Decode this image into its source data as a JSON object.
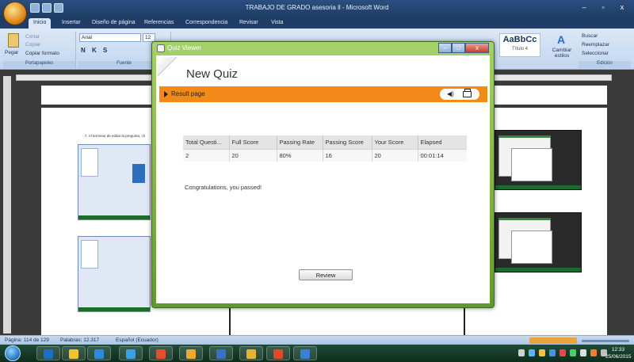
{
  "word": {
    "window_title": "TRABAJO DE GRADO asesoria ll - Microsoft Word",
    "window_controls": {
      "minimize": "–",
      "restore": "▫",
      "close": "x"
    },
    "tabs": [
      "Inicio",
      "Insertar",
      "Diseño de página",
      "Referencias",
      "Correspondencia",
      "Revisar",
      "Vista"
    ],
    "ribbon": {
      "clipboard": {
        "paste": "Pegar",
        "cut": "Cortar",
        "copy": "Copiar",
        "format_painter": "Copiar formato",
        "group": "Portapapeles"
      },
      "font": {
        "name": "Arial",
        "size": "12",
        "group": "Fuente"
      },
      "styles": {
        "preview": "AaBbCc",
        "name": "Título 4",
        "change": "Cambiar estilos"
      },
      "editing": {
        "find": "Buscar",
        "replace": "Reemplazar",
        "select": "Seleccionar",
        "group": "Edición"
      }
    },
    "document_text": "7. Al terminar de editar la pregunta, cli",
    "statusbar": {
      "page": "Página: 114 de 129",
      "words": "Palabras: 12.317",
      "language": "Español (Ecuador)"
    }
  },
  "taskbar": {
    "time": "12:33",
    "date": "25/06/2015",
    "app_colors": [
      "#1e6fc1",
      "#f2c230",
      "#2d8ad6",
      "#3aa0e0",
      "#e74c2c",
      "#f0a830",
      "#3b6fbf",
      "#e7b23c",
      "#d94d2b",
      "#3a7fd5"
    ]
  },
  "quiz_viewer": {
    "window_title": "Quiz Viewer",
    "window_controls": {
      "minimize": "–",
      "maximize": "□",
      "close": "x"
    },
    "quiz_title": "New Quiz",
    "result_label": "Result page",
    "table": {
      "headers": [
        "Total Questi...",
        "Full Score",
        "Passing Rate",
        "Passing Score",
        "Your Score",
        "Elapsed"
      ],
      "row": [
        "2",
        "20",
        "80%",
        "16",
        "20",
        "00:01:14"
      ]
    },
    "message": "Congratulations, you passed!",
    "review_label": "Review"
  }
}
